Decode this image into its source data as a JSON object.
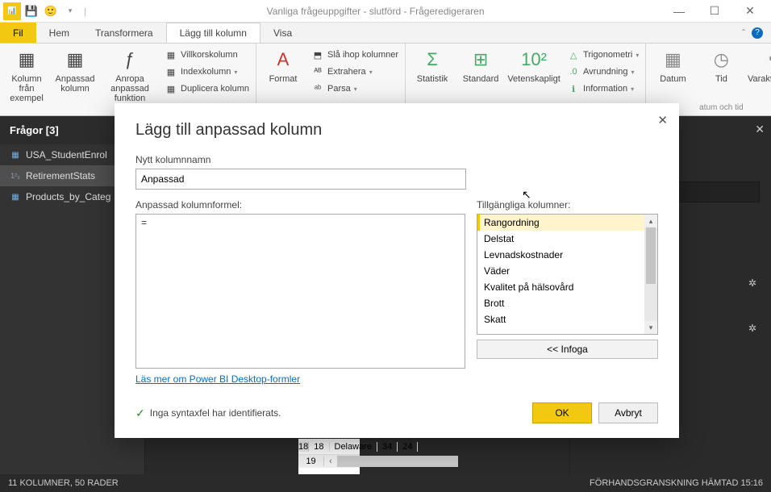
{
  "titlebar": {
    "title": "Vanliga frågeuppgifter - slutförd - Frågeredigeraren"
  },
  "tabs": {
    "file": "Fil",
    "home": "Hem",
    "transform": "Transformera",
    "addcol": "Lägg till kolumn",
    "view": "Visa"
  },
  "ribbon": {
    "exampleCol": "Kolumn från exempel",
    "customCol": "Anpassad kolumn",
    "invokeFn": "Anropa anpassad funktion",
    "conditional": "Villkorskolumn",
    "index": "Indexkolumn",
    "duplicate": "Duplicera kolumn",
    "format": "Format",
    "merge": "Slå ihop kolumner",
    "extract": "Extrahera",
    "parse": "Parsa",
    "statistics": "Statistik",
    "standard": "Standard",
    "scientific": "Vetenskapligt",
    "trig": "Trigonometri",
    "rounding": "Avrundning",
    "info": "Information",
    "date": "Datum",
    "time": "Tid",
    "duration": "Varaktighet",
    "datetimeGroup": "atum och tid"
  },
  "queries": {
    "header": "Frågor [3]",
    "items": [
      "USA_StudentEnrol",
      "RetirementStats",
      "Products_by_Categ"
    ]
  },
  "table": {
    "row18": {
      "num": "18",
      "c1": "18",
      "c2": "Delaware",
      "c3": "34",
      "c4": "24"
    },
    "row19": {
      "num": "19"
    }
  },
  "modal": {
    "title": "Lägg till anpassad kolumn",
    "newColLabel": "Nytt kolumnnamn",
    "newColValue": "Anpassad",
    "formulaLabel": "Anpassad kolumnformel:",
    "formulaValue": "=",
    "availLabel": "Tillgängliga kolumner:",
    "availItems": [
      "Rangordning",
      "Delstat",
      "Levnadskostnader",
      "Väder",
      "Kvalitet på hälsovård",
      "Brott",
      "Skatt"
    ],
    "insert": "<< Infoga",
    "link": "Läs mer om Power BI Desktop-formler",
    "syntax": "Inga syntaxfel har identifierats.",
    "ok": "OK",
    "cancel": "Avbryt"
  },
  "status": {
    "left": "11 KOLUMNER, 50 RADER",
    "right": "FÖRHANDSGRANSKNING HÄMTAD 15:16"
  }
}
